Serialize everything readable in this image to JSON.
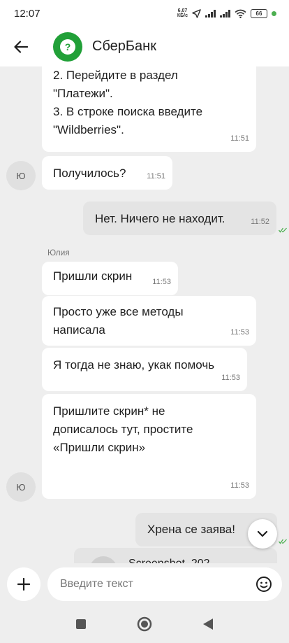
{
  "status_bar": {
    "time": "12:07",
    "speed_value": "6,07",
    "speed_unit": "КБ/с",
    "battery": "66"
  },
  "header": {
    "title": "СберБанк"
  },
  "messages": [
    {
      "from": "bank",
      "lines": [
        "2. Перейдите в раздел",
        "\"Платежи\".",
        "3. В строке поиска введите",
        "\"Wildberries\"."
      ],
      "time": "11:51"
    },
    {
      "from": "bank",
      "text": "Получилось?",
      "time": "11:51",
      "avatar": "Ю"
    },
    {
      "from": "me",
      "text": "Нет. Ничего не находит.",
      "time": "11:52"
    },
    {
      "from": "bank",
      "sender": "Юлия",
      "text": "Пришли скрин",
      "time": "11:53"
    },
    {
      "from": "bank",
      "lines": [
        "Просто уже все методы",
        "написала"
      ],
      "time": "11:53"
    },
    {
      "from": "bank",
      "text": "Я тогда не знаю, укак помочь",
      "time": "11:53"
    },
    {
      "from": "bank",
      "lines": [
        "Пришлите скрин* не",
        "дописалось тут, простите",
        "«Пришли скрин»"
      ],
      "time": "11:53",
      "avatar": "Ю"
    },
    {
      "from": "me",
      "text": "Хрена се заява!"
    }
  ],
  "partial_message": {
    "text": "Screenshot_202..."
  },
  "composer": {
    "placeholder": "Введите текст"
  },
  "colors": {
    "brand": "#21a038",
    "background": "#eeeeee",
    "bubble_in": "#ffffff",
    "bubble_out": "#e4e4e4",
    "read_check": "#4caf50"
  }
}
